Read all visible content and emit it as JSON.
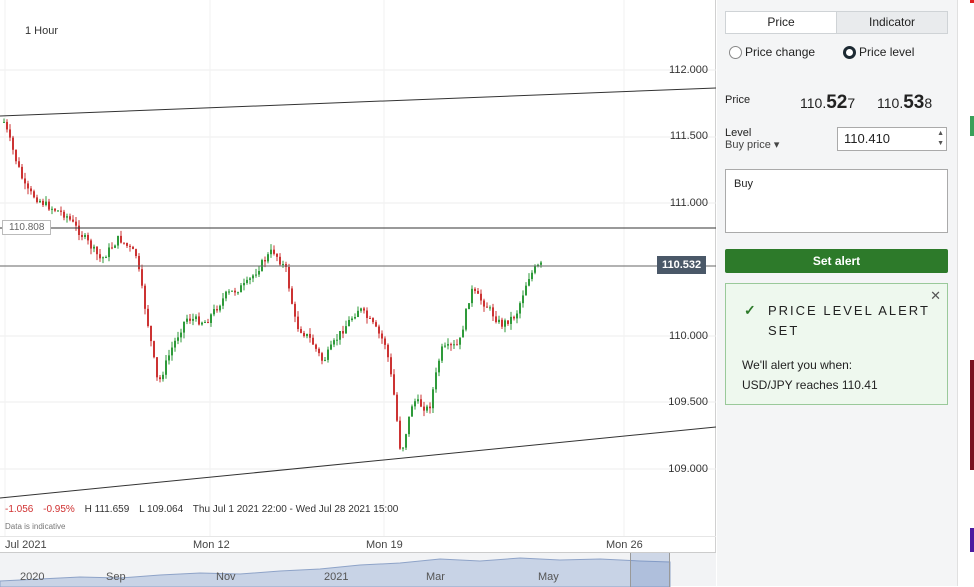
{
  "chart": {
    "timeframe": "1 Hour",
    "y_ticks": [
      "112.000",
      "111.500",
      "111.000",
      "110.000",
      "109.500",
      "109.000"
    ],
    "level_tag": "110.808",
    "current_price_tag": "110.532",
    "stats": {
      "change": "-1.056",
      "change_pct": "-0.95%",
      "high": "H 111.659",
      "low": "L 109.064",
      "range": "Thu Jul 1 2021 22:00 - Wed Jul 28 2021 15:00"
    },
    "disclaimer": "Data is indicative",
    "x_labels": [
      "Jul 2021",
      "Mon 12",
      "Mon 19",
      "Mon 26"
    ],
    "navigator_labels": [
      "2020",
      "Sep",
      "Nov",
      "2021",
      "Mar",
      "May"
    ],
    "colors": {
      "up": "#2e9a3a",
      "down": "#cc3333",
      "line": "#333333"
    }
  },
  "panel": {
    "tabs": [
      "Price",
      "Indicator"
    ],
    "radios": [
      "Price change",
      "Price level"
    ],
    "selected_radio": "Price level",
    "price_label": "Price",
    "bid": {
      "prefix": "110.",
      "big": "52",
      "suffix": "7"
    },
    "ask": {
      "prefix": "110.",
      "big": "53",
      "suffix": "8"
    },
    "level_label": "Level",
    "level_type": "Buy price",
    "level_value": "110.410",
    "note_text": "Buy",
    "set_alert_label": "Set alert",
    "confirmation": {
      "title": "PRICE LEVEL ALERT SET",
      "line1": "We'll alert you when:",
      "line2": "USD/JPY reaches 110.41"
    },
    "colors": {
      "button": "#2d7a2a",
      "confirm_bg": "#eef8ee"
    }
  }
}
